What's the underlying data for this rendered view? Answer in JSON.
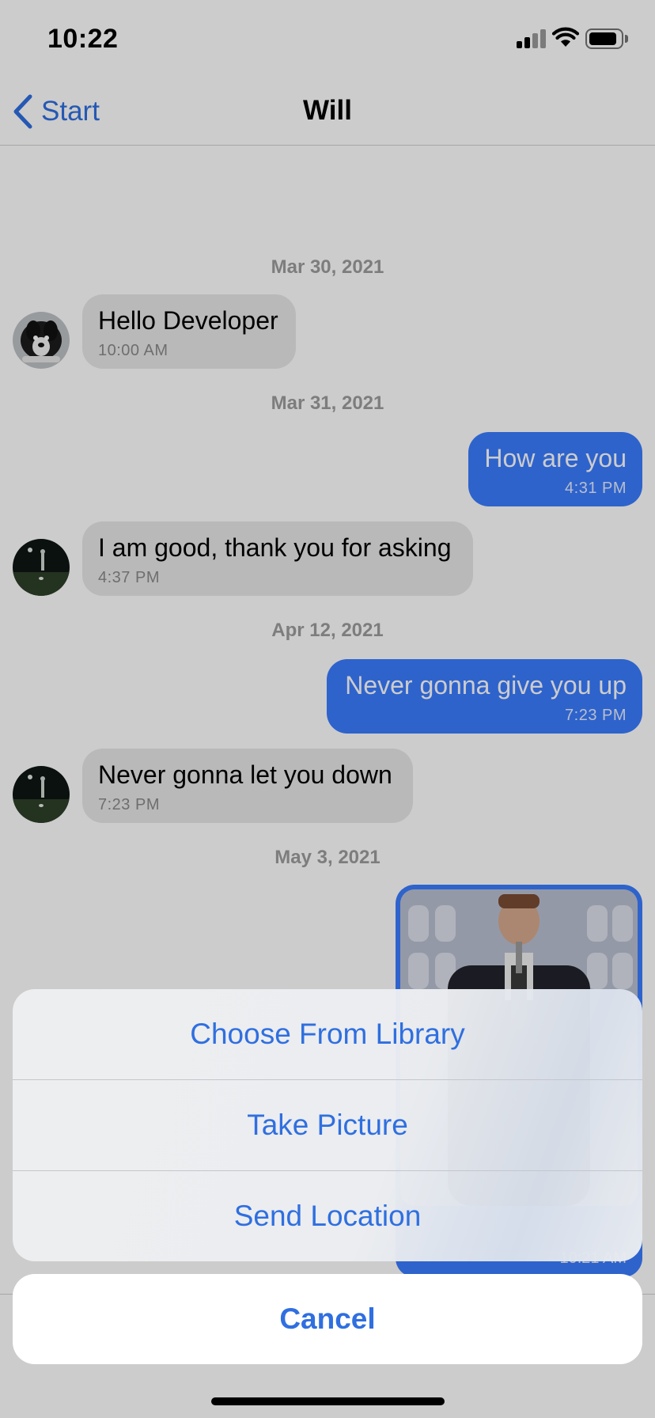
{
  "status_bar": {
    "time": "10:22"
  },
  "nav": {
    "back_label": "Start",
    "title": "Will"
  },
  "chat": {
    "dates": [
      "Mar 30, 2021",
      "Mar 31, 2021",
      "Apr 12, 2021",
      "May 3, 2021"
    ],
    "messages": [
      {
        "direction": "incoming",
        "text": "Hello Developer",
        "time": "10:00 AM"
      },
      {
        "direction": "outgoing",
        "text": "How are you",
        "time": "4:31 PM"
      },
      {
        "direction": "incoming",
        "text": "I am good, thank you for asking",
        "time": "4:37 PM"
      },
      {
        "direction": "outgoing",
        "text": "Never gonna give you up",
        "time": "7:23 PM"
      },
      {
        "direction": "incoming",
        "text": "Never gonna let you down",
        "time": "7:23 PM"
      },
      {
        "direction": "outgoing",
        "type": "image",
        "time": "10:21 AM"
      }
    ]
  },
  "action_sheet": {
    "items": [
      "Choose From Library",
      "Take Picture",
      "Send Location"
    ],
    "cancel_label": "Cancel"
  },
  "colors": {
    "accent": "#2f6fe0",
    "outgoing_bubble": "#3a7cff",
    "incoming_bubble": "#e8e8e8"
  }
}
